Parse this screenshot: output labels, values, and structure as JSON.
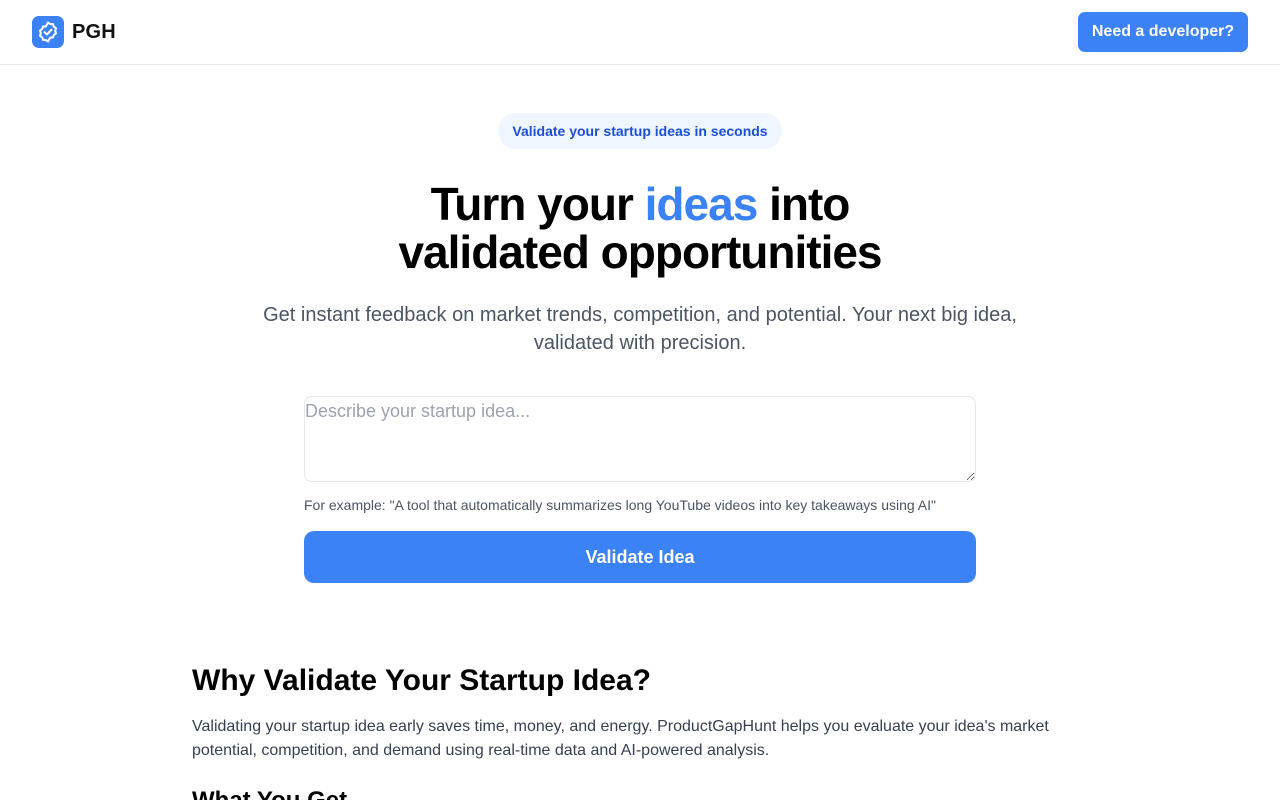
{
  "header": {
    "logo_text": "PGH",
    "logo_icon": "badge-check-icon",
    "cta_label": "Need a developer?"
  },
  "hero": {
    "badge": "Validate your startup ideas in seconds",
    "title_part1": "Turn your ",
    "title_accent": "ideas",
    "title_part2": " into",
    "title_line2": "validated opportunities",
    "subtitle": "Get instant feedback on market trends, competition, and potential. Your next big idea, validated with precision."
  },
  "form": {
    "input_value": "",
    "input_placeholder": "Describe your startup idea...",
    "example_text": "For example: \"A tool that automatically summarizes long YouTube videos into key takeaways using AI\"",
    "submit_label": "Validate Idea"
  },
  "why": {
    "heading": "Why Validate Your Startup Idea?",
    "body": "Validating your startup idea early saves time, money, and energy. ProductGapHunt helps you evaluate your idea's market potential, competition, and demand using real-time data and AI-powered analysis.",
    "next_heading": "What You Get"
  },
  "colors": {
    "accent": "#3b82f6",
    "badge_bg": "#eff6ff",
    "badge_text": "#1d4ed8",
    "muted_text": "#4b5563"
  }
}
